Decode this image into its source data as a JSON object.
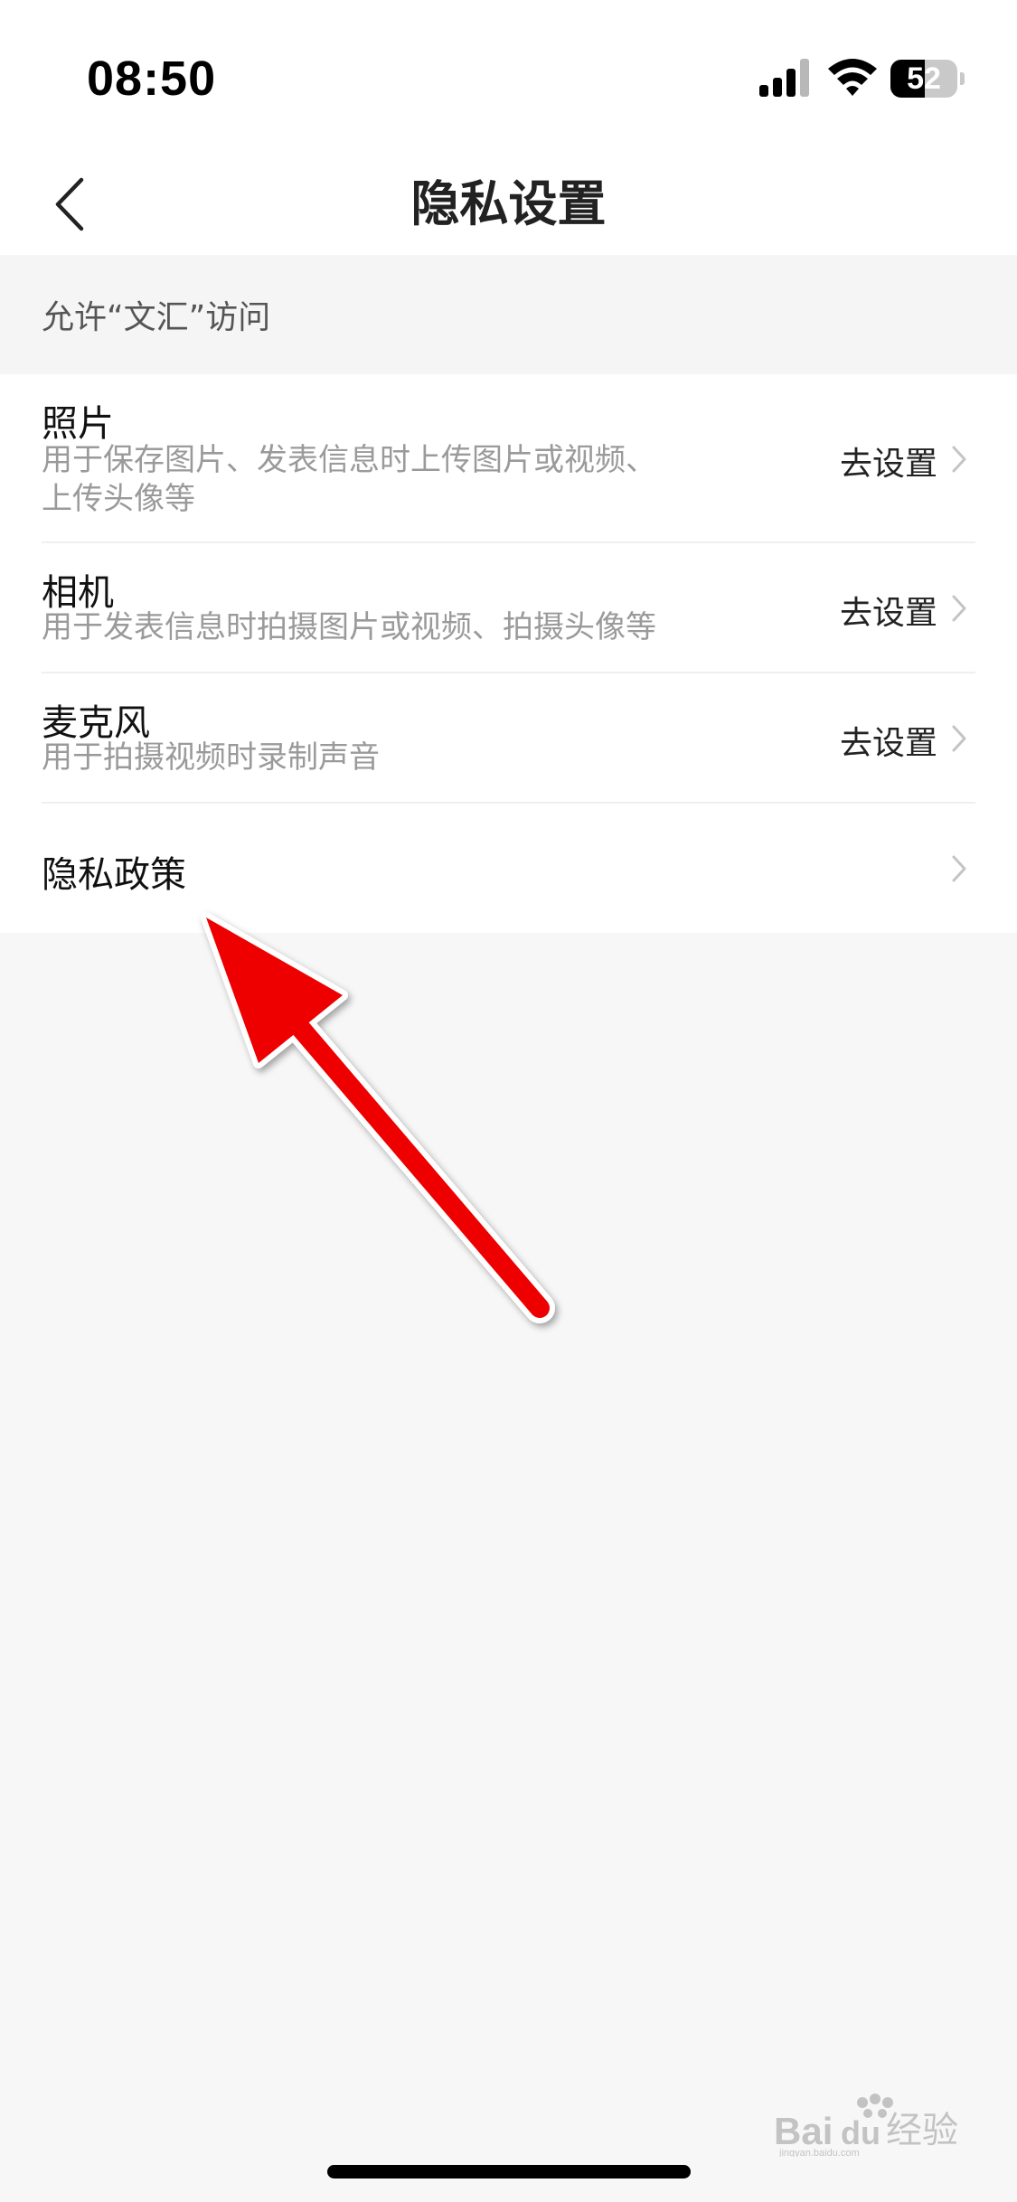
{
  "status_bar": {
    "time": "08:50",
    "battery_level": "52",
    "battery_fraction": 0.52,
    "icons": [
      "signal-icon",
      "wifi-icon",
      "battery-icon"
    ]
  },
  "nav": {
    "title": "隐私设置",
    "back_icon": "chevron-left-icon"
  },
  "section": {
    "header": "允许“文汇”访问"
  },
  "items": [
    {
      "title": "照片",
      "desc_lines": [
        "用于保存图片、发表信息时上传图片或视频、",
        "上传头像等"
      ],
      "action": "去设置"
    },
    {
      "title": "相机",
      "desc_lines": [
        "用于发表信息时拍摄图片或视频、拍摄头像等"
      ],
      "action": "去设置"
    },
    {
      "title": "麦克风",
      "desc_lines": [
        "用于拍摄视频时录制声音"
      ],
      "action": "去设置"
    },
    {
      "title": "隐私政策",
      "action": ""
    }
  ],
  "annotation": {
    "color": "#ee0000",
    "icon": "arrow-icon"
  },
  "watermark": {
    "text": "Baidu 经验",
    "subtext": "jingyan.baidu.com"
  },
  "colors": {
    "background": "#f7f7f7",
    "surface": "#ffffff",
    "secondary_text": "#9a9a9a",
    "chevron": "#c4c4c4"
  }
}
